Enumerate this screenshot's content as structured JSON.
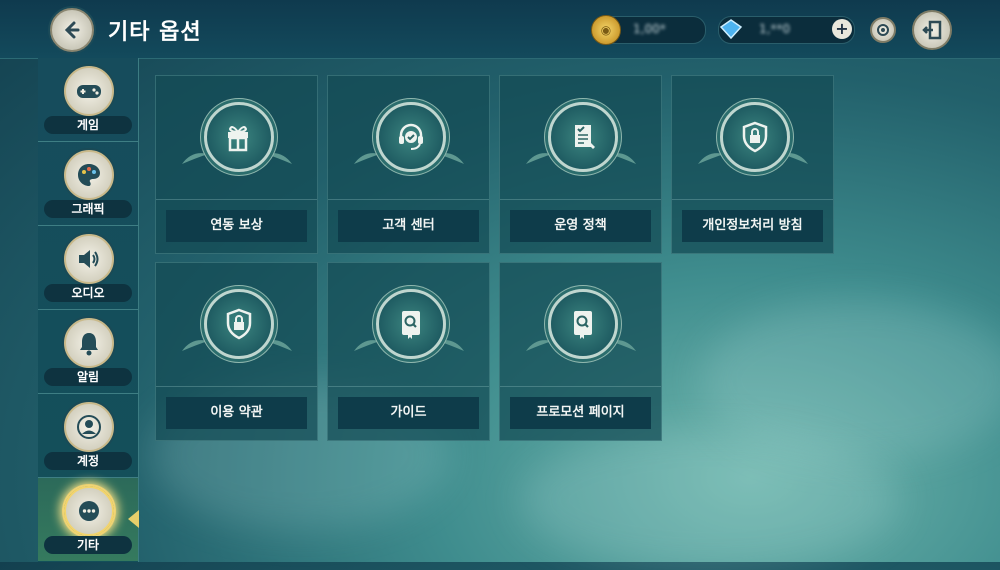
{
  "header": {
    "title": "기타 옵션"
  },
  "currencies": [
    {
      "icon": "gold-coin-icon",
      "value": "1,00*"
    },
    {
      "icon": "blue-diamond-icon",
      "value": "1,**0"
    }
  ],
  "sidebar": {
    "items": [
      {
        "label": "게임",
        "icon": "gamepad-icon"
      },
      {
        "label": "그래픽",
        "icon": "palette-icon"
      },
      {
        "label": "오디오",
        "icon": "speaker-icon"
      },
      {
        "label": "알림",
        "icon": "bell-icon"
      },
      {
        "label": "계정",
        "icon": "user-icon"
      },
      {
        "label": "기타",
        "icon": "more-icon",
        "active": true
      }
    ]
  },
  "cards": [
    {
      "label": "연동 보상",
      "icon": "gift-link-icon"
    },
    {
      "label": "고객 센터",
      "icon": "headset-icon"
    },
    {
      "label": "운영 정책",
      "icon": "policy-document-icon"
    },
    {
      "label": "개인정보처리 방침",
      "icon": "shield-lock-icon"
    },
    {
      "label": "이용 약관",
      "icon": "shield-lock-icon"
    },
    {
      "label": "가이드",
      "icon": "guide-book-icon"
    },
    {
      "label": "프로모션 페이지",
      "icon": "guide-book-icon"
    }
  ],
  "colors": {
    "accent": "#e7cf6a",
    "panel": "#144b55",
    "button": "#0e3c4a"
  }
}
